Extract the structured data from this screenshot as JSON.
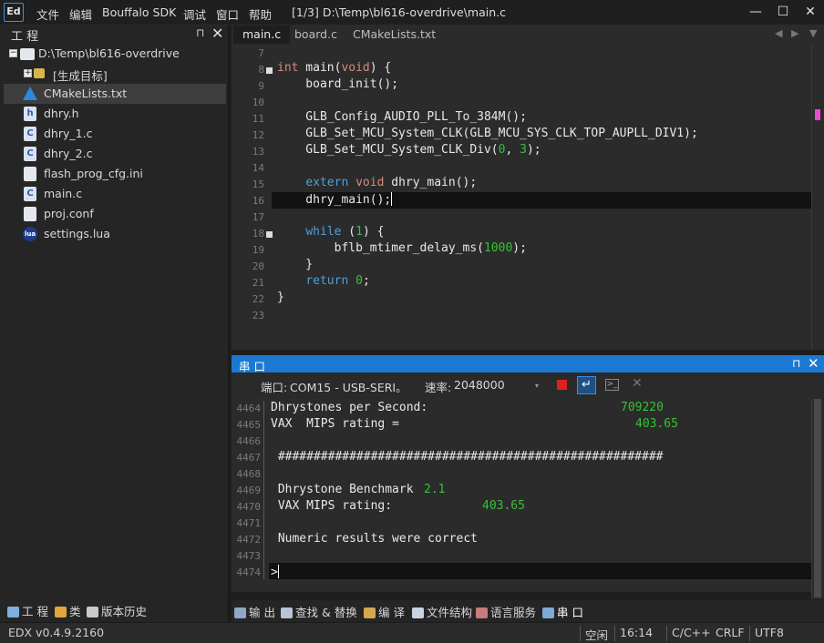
{
  "app": {
    "logo": "Ed",
    "menu": [
      "文件",
      "编辑",
      "Bouffalo SDK",
      "调试",
      "窗口",
      "帮助"
    ],
    "window_title": "[1/3] D:\\Temp\\bl616-overdrive\\main.c",
    "controls": {
      "minimize": "—",
      "maximize": "☐",
      "close": "✕"
    }
  },
  "project_panel": {
    "title": "工 程",
    "pin": "⊓",
    "close": "✕",
    "tree": [
      {
        "label": "D:\\Temp\\bl616-overdrive",
        "icon": "project-icon"
      },
      {
        "label": "[生成目标]",
        "icon": "folder-icon"
      },
      {
        "label": "CMakeLists.txt",
        "icon": "cmake-icon"
      },
      {
        "label": "dhry.h",
        "icon": "h-file-icon"
      },
      {
        "label": "dhry_1.c",
        "icon": "c-file-icon"
      },
      {
        "label": "dhry_2.c",
        "icon": "c-file-icon"
      },
      {
        "label": "flash_prog_cfg.ini",
        "icon": "document-icon"
      },
      {
        "label": "main.c",
        "icon": "c-file-icon"
      },
      {
        "label": "proj.conf",
        "icon": "document-icon"
      },
      {
        "label": "settings.lua",
        "icon": "lua-icon"
      }
    ],
    "bottom_tabs": [
      "工 程",
      "类",
      "版本历史"
    ]
  },
  "editor": {
    "tabs": [
      "main.c",
      "board.c",
      "CMakeLists.txt"
    ],
    "line_numbers": [
      "7",
      "8",
      "9",
      "10",
      "11",
      "12",
      "13",
      "14",
      "15",
      "16",
      "17",
      "18",
      "19",
      "20",
      "21",
      "22",
      "23"
    ],
    "code": {
      "l8_kw": "int",
      "l8_rest": " main(",
      "l8_void": "void",
      "l8_end": ") {",
      "l9": "    board_init();",
      "l11": "    GLB_Config_AUDIO_PLL_To_384M();",
      "l12": "    GLB_Set_MCU_System_CLK(GLB_MCU_SYS_CLK_TOP_AUPLL_DIV1);",
      "l13_a": "    GLB_Set_MCU_System_CLK_Div(",
      "l13_n1": "0",
      "l13_b": ", ",
      "l13_n2": "3",
      "l13_c": ");",
      "l15_a": "    ",
      "l15_kw": "extern",
      "l15_sp": " ",
      "l15_void": "void",
      "l15_rest": " dhry_main();",
      "l16": "    dhry_main();",
      "l18_a": "    ",
      "l18_kw": "while",
      "l18_b": " (",
      "l18_n": "1",
      "l18_c": ") {",
      "l19_a": "        bflb_mtimer_delay_ms(",
      "l19_n": "1000",
      "l19_b": ");",
      "l20": "    }",
      "l21_a": "    ",
      "l21_kw": "return",
      "l21_b": " ",
      "l21_n": "0",
      "l21_c": ";",
      "l22": "}"
    }
  },
  "serial": {
    "title": "串 口",
    "pin": "⊓",
    "close": "✕",
    "port_label": "端口:",
    "port_value": "COM15 - USB-SERI。",
    "baud_label": "速率:",
    "baud_value": "2048000",
    "line_numbers": [
      "4464",
      "4465",
      "4466",
      "4467",
      "4468",
      "4469",
      "4470",
      "4471",
      "4472",
      "4473",
      "4474"
    ],
    "output": {
      "l4464": "Dhrystones per Second:",
      "l4464_v": "709220",
      "l4465": "VAX  MIPS rating =",
      "l4465_v": "403.65",
      "l4467": " ######################################################",
      "l4469": " Dhrystone Benchmark",
      "l4469_v": "2.1",
      "l4470": " VAX MIPS rating:",
      "l4470_v": "403.65",
      "l4472": " Numeric results were correct",
      "l4474": ">"
    }
  },
  "bottom_panel_tabs": [
    "输 出",
    "查找 & 替换",
    "编 译",
    "文件结构",
    "语言服务",
    "串 口"
  ],
  "status_bar": {
    "version": "EDX v0.4.9.2160",
    "selection": "空闲",
    "position": "16:14",
    "language": "C/C++",
    "line_ending": "CRLF",
    "encoding": "UTF8"
  },
  "colors": {
    "accent": "#1c79d1",
    "keyword": "#d58a7c",
    "type_keyword": "#4f9fd9",
    "number": "#36c236"
  }
}
